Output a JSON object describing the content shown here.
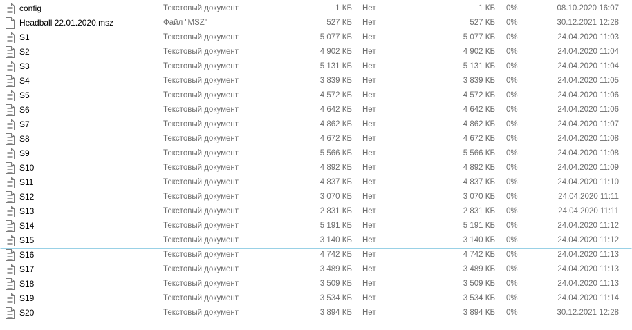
{
  "file_list": {
    "focused_row": 17,
    "icon": "text-document-icon",
    "rows": [
      {
        "name": "config",
        "type": "Текстовый документ",
        "size": "1 КБ",
        "protected": "Нет",
        "packed": "1 КБ",
        "ratio": "0%",
        "date": "08.10.2020 16:07"
      },
      {
        "name": "Headball 22.01.2020.msz",
        "type": "Файл \"MSZ\"",
        "size": "527 КБ",
        "protected": "Нет",
        "packed": "527 КБ",
        "ratio": "0%",
        "date": "30.12.2021 12:28"
      },
      {
        "name": "S1",
        "type": "Текстовый документ",
        "size": "5 077 КБ",
        "protected": "Нет",
        "packed": "5 077 КБ",
        "ratio": "0%",
        "date": "24.04.2020 11:03"
      },
      {
        "name": "S2",
        "type": "Текстовый документ",
        "size": "4 902 КБ",
        "protected": "Нет",
        "packed": "4 902 КБ",
        "ratio": "0%",
        "date": "24.04.2020 11:04"
      },
      {
        "name": "S3",
        "type": "Текстовый документ",
        "size": "5 131 КБ",
        "protected": "Нет",
        "packed": "5 131 КБ",
        "ratio": "0%",
        "date": "24.04.2020 11:04"
      },
      {
        "name": "S4",
        "type": "Текстовый документ",
        "size": "3 839 КБ",
        "protected": "Нет",
        "packed": "3 839 КБ",
        "ratio": "0%",
        "date": "24.04.2020 11:05"
      },
      {
        "name": "S5",
        "type": "Текстовый документ",
        "size": "4 572 КБ",
        "protected": "Нет",
        "packed": "4 572 КБ",
        "ratio": "0%",
        "date": "24.04.2020 11:06"
      },
      {
        "name": "S6",
        "type": "Текстовый документ",
        "size": "4 642 КБ",
        "protected": "Нет",
        "packed": "4 642 КБ",
        "ratio": "0%",
        "date": "24.04.2020 11:06"
      },
      {
        "name": "S7",
        "type": "Текстовый документ",
        "size": "4 862 КБ",
        "protected": "Нет",
        "packed": "4 862 КБ",
        "ratio": "0%",
        "date": "24.04.2020 11:07"
      },
      {
        "name": "S8",
        "type": "Текстовый документ",
        "size": "4 672 КБ",
        "protected": "Нет",
        "packed": "4 672 КБ",
        "ratio": "0%",
        "date": "24.04.2020 11:08"
      },
      {
        "name": "S9",
        "type": "Текстовый документ",
        "size": "5 566 КБ",
        "protected": "Нет",
        "packed": "5 566 КБ",
        "ratio": "0%",
        "date": "24.04.2020 11:08"
      },
      {
        "name": "S10",
        "type": "Текстовый документ",
        "size": "4 892 КБ",
        "protected": "Нет",
        "packed": "4 892 КБ",
        "ratio": "0%",
        "date": "24.04.2020 11:09"
      },
      {
        "name": "S11",
        "type": "Текстовый документ",
        "size": "4 837 КБ",
        "protected": "Нет",
        "packed": "4 837 КБ",
        "ratio": "0%",
        "date": "24.04.2020 11:10"
      },
      {
        "name": "S12",
        "type": "Текстовый документ",
        "size": "3 070 КБ",
        "protected": "Нет",
        "packed": "3 070 КБ",
        "ratio": "0%",
        "date": "24.04.2020 11:11"
      },
      {
        "name": "S13",
        "type": "Текстовый документ",
        "size": "2 831 КБ",
        "protected": "Нет",
        "packed": "2 831 КБ",
        "ratio": "0%",
        "date": "24.04.2020 11:11"
      },
      {
        "name": "S14",
        "type": "Текстовый документ",
        "size": "5 191 КБ",
        "protected": "Нет",
        "packed": "5 191 КБ",
        "ratio": "0%",
        "date": "24.04.2020 11:12"
      },
      {
        "name": "S15",
        "type": "Текстовый документ",
        "size": "3 140 КБ",
        "protected": "Нет",
        "packed": "3 140 КБ",
        "ratio": "0%",
        "date": "24.04.2020 11:12"
      },
      {
        "name": "S16",
        "type": "Текстовый документ",
        "size": "4 742 КБ",
        "protected": "Нет",
        "packed": "4 742 КБ",
        "ratio": "0%",
        "date": "24.04.2020 11:13"
      },
      {
        "name": "S17",
        "type": "Текстовый документ",
        "size": "3 489 КБ",
        "protected": "Нет",
        "packed": "3 489 КБ",
        "ratio": "0%",
        "date": "24.04.2020 11:13"
      },
      {
        "name": "S18",
        "type": "Текстовый документ",
        "size": "3 509 КБ",
        "protected": "Нет",
        "packed": "3 509 КБ",
        "ratio": "0%",
        "date": "24.04.2020 11:13"
      },
      {
        "name": "S19",
        "type": "Текстовый документ",
        "size": "3 534 КБ",
        "protected": "Нет",
        "packed": "3 534 КБ",
        "ratio": "0%",
        "date": "24.04.2020 11:14"
      },
      {
        "name": "S20",
        "type": "Текстовый документ",
        "size": "3 894 КБ",
        "protected": "Нет",
        "packed": "3 894 КБ",
        "ratio": "0%",
        "date": "30.12.2021 12:28"
      }
    ]
  }
}
